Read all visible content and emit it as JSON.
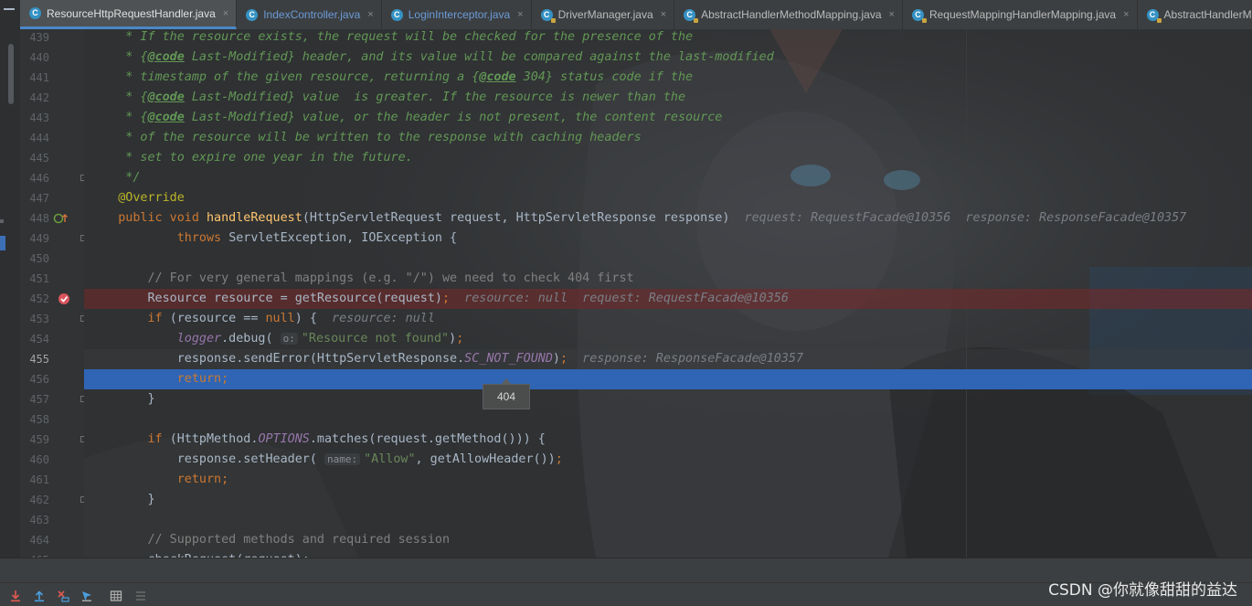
{
  "tabs": [
    {
      "label": "ResourceHttpRequestHandler.java",
      "active": true,
      "style": "default",
      "icon": "class-c-icon"
    },
    {
      "label": "IndexController.java",
      "active": false,
      "style": "blue",
      "icon": "class-c-icon"
    },
    {
      "label": "LoginInterceptor.java",
      "active": false,
      "style": "blue",
      "icon": "class-c-icon"
    },
    {
      "label": "DriverManager.java",
      "active": false,
      "style": "default",
      "icon": "class-c-icon-locked"
    },
    {
      "label": "AbstractHandlerMethodMapping.java",
      "active": false,
      "style": "default",
      "icon": "class-c-icon-locked"
    },
    {
      "label": "RequestMappingHandlerMapping.java",
      "active": false,
      "style": "default",
      "icon": "class-c-icon-locked"
    },
    {
      "label": "AbstractHandlerMapping",
      "active": false,
      "style": "default",
      "icon": "class-c-icon-locked"
    }
  ],
  "code": {
    "lines": [
      {
        "n": "439",
        "state": "",
        "gutter": "",
        "tokens": [
          [
            "doc",
            "     * If the resource exists, the request will be checked for the presence of the"
          ]
        ]
      },
      {
        "n": "440",
        "state": "",
        "gutter": "",
        "tokens": [
          [
            "doc",
            "     * {"
          ],
          [
            "doctag",
            "@code"
          ],
          [
            "doc",
            " Last-Modified} header, and its value will be compared against the last-modified"
          ]
        ]
      },
      {
        "n": "441",
        "state": "",
        "gutter": "",
        "tokens": [
          [
            "doc",
            "     * timestamp of the given resource, returning a {"
          ],
          [
            "doctag",
            "@code"
          ],
          [
            "doc",
            " 304} status code if the"
          ]
        ]
      },
      {
        "n": "442",
        "state": "",
        "gutter": "",
        "tokens": [
          [
            "doc",
            "     * {"
          ],
          [
            "doctag",
            "@code"
          ],
          [
            "doc",
            " Last-Modified} value  is greater. If the resource is newer than the"
          ]
        ]
      },
      {
        "n": "443",
        "state": "",
        "gutter": "",
        "tokens": [
          [
            "doc",
            "     * {"
          ],
          [
            "doctag",
            "@code"
          ],
          [
            "doc",
            " Last-Modified} value, or the header is not present, the content resource"
          ]
        ]
      },
      {
        "n": "444",
        "state": "",
        "gutter": "",
        "tokens": [
          [
            "doc",
            "     * of the resource will be written to the response with caching headers"
          ]
        ]
      },
      {
        "n": "445",
        "state": "",
        "gutter": "",
        "tokens": [
          [
            "doc",
            "     * set to expire one year in the future."
          ]
        ]
      },
      {
        "n": "446",
        "state": "",
        "gutter": "fold",
        "tokens": [
          [
            "doc",
            "     */"
          ]
        ]
      },
      {
        "n": "447",
        "state": "",
        "gutter": "",
        "tokens": [
          [
            "ann",
            "    @Override"
          ]
        ]
      },
      {
        "n": "448",
        "state": "",
        "gutter": "override",
        "tokens": [
          [
            "kw",
            "    public void "
          ],
          [
            "fn",
            "handleRequest"
          ],
          [
            "",
            "(HttpServletRequest request, HttpServletResponse response)"
          ],
          [
            "hint",
            "  request: RequestFacade@10356  response: ResponseFacade@10357"
          ]
        ]
      },
      {
        "n": "449",
        "state": "",
        "gutter": "fold",
        "tokens": [
          [
            "kw",
            "            throws "
          ],
          [
            "",
            "ServletException, IOException {"
          ]
        ]
      },
      {
        "n": "450",
        "state": "",
        "gutter": "",
        "tokens": [
          [
            "",
            ""
          ]
        ]
      },
      {
        "n": "451",
        "state": "",
        "gutter": "",
        "tokens": [
          [
            "cmt",
            "        // For very general mappings (e.g. \"/\") we need to check 404 first"
          ]
        ]
      },
      {
        "n": "452",
        "state": "bp",
        "gutter": "breakpoint",
        "tokens": [
          [
            "",
            "        Resource resource = getResource(request)"
          ],
          [
            "kw",
            ";"
          ],
          [
            "hint",
            "  resource: null  request: RequestFacade@10356"
          ]
        ]
      },
      {
        "n": "453",
        "state": "",
        "gutter": "fold",
        "tokens": [
          [
            "kw",
            "        if "
          ],
          [
            "",
            "(resource == "
          ],
          [
            "kw",
            "null"
          ],
          [
            "",
            ") {"
          ],
          [
            "hint",
            "  resource: null"
          ]
        ]
      },
      {
        "n": "454",
        "state": "",
        "gutter": "",
        "tokens": [
          [
            "fld",
            "            logger"
          ],
          [
            "",
            ".debug( "
          ],
          [
            "phint",
            "o:"
          ],
          [
            "str",
            "\"Resource not found\""
          ],
          [
            "",
            ")"
          ],
          [
            "kw",
            ";"
          ]
        ]
      },
      {
        "n": "455",
        "state": "cur",
        "gutter": "",
        "tokens": [
          [
            "",
            "            response.sendError(HttpServletResponse."
          ],
          [
            "fld",
            "SC_NOT_FOUND"
          ],
          [
            "",
            ")"
          ],
          [
            "kw",
            ";"
          ],
          [
            "hint",
            "  response: ResponseFacade@10357"
          ]
        ]
      },
      {
        "n": "456",
        "state": "exec",
        "gutter": "",
        "tokens": [
          [
            "kw",
            "            return;"
          ]
        ]
      },
      {
        "n": "457",
        "state": "",
        "gutter": "fold",
        "tokens": [
          [
            "",
            "        }"
          ]
        ]
      },
      {
        "n": "458",
        "state": "",
        "gutter": "",
        "tokens": [
          [
            "",
            ""
          ]
        ]
      },
      {
        "n": "459",
        "state": "",
        "gutter": "fold",
        "tokens": [
          [
            "kw",
            "        if "
          ],
          [
            "",
            "(HttpMethod."
          ],
          [
            "fld",
            "OPTIONS"
          ],
          [
            "",
            ".matches(request.getMethod())) {"
          ]
        ]
      },
      {
        "n": "460",
        "state": "",
        "gutter": "",
        "tokens": [
          [
            "",
            "            response.setHeader( "
          ],
          [
            "phint",
            "name:"
          ],
          [
            "str",
            "\"Allow\""
          ],
          [
            "",
            ", getAllowHeader())"
          ],
          [
            "kw",
            ";"
          ]
        ]
      },
      {
        "n": "461",
        "state": "",
        "gutter": "",
        "tokens": [
          [
            "kw",
            "            return;"
          ]
        ]
      },
      {
        "n": "462",
        "state": "",
        "gutter": "fold",
        "tokens": [
          [
            "",
            "        }"
          ]
        ]
      },
      {
        "n": "463",
        "state": "",
        "gutter": "",
        "tokens": [
          [
            "",
            ""
          ]
        ]
      },
      {
        "n": "464",
        "state": "",
        "gutter": "",
        "tokens": [
          [
            "cmt",
            "        // Supported methods and required session"
          ]
        ]
      },
      {
        "n": "465",
        "state": "",
        "gutter": "",
        "tokens": [
          [
            "",
            "        checkRequest(request);"
          ]
        ]
      }
    ]
  },
  "tooltip": {
    "value": "404"
  },
  "bottom_tools": [
    {
      "icon": "download-arrow-icon",
      "color": "#e05a4f"
    },
    {
      "icon": "upload-arrow-icon",
      "color": "#4a9fe0"
    },
    {
      "icon": "close-step-icon",
      "color": "#e05a4f"
    },
    {
      "icon": "step-cursor-icon",
      "color": "#4a9fe0"
    },
    {
      "icon": "table-grid-icon",
      "color": "#b0b0b0"
    },
    {
      "icon": "list-settings-icon",
      "color": "#6b6b6b"
    }
  ],
  "watermark": "CSDN @你就像甜甜的益达",
  "colors": {
    "keyword": "#cc7832",
    "doc_comment": "#629755",
    "annotation": "#bbb529",
    "method": "#ffc66d",
    "string": "#6a8759",
    "field": "#9876aa",
    "breakpoint_line": "#5a2a2a",
    "execution_line": "#2f65b4",
    "tab_active_underline": "#4a88c7"
  }
}
